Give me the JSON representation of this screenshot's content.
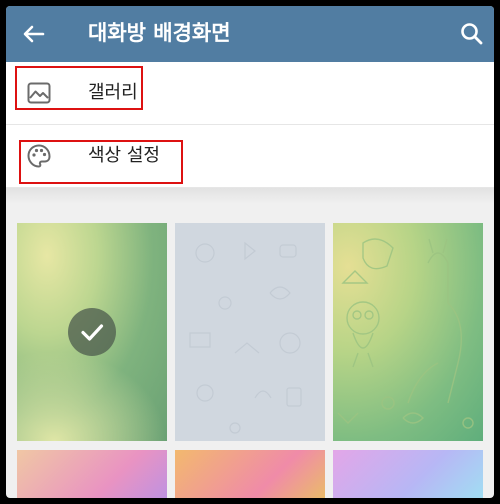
{
  "appbar": {
    "title": "대화방 배경화면",
    "back_icon": "arrow-left-icon",
    "search_icon": "search-icon"
  },
  "menu": {
    "items": [
      {
        "label": "갤러리",
        "icon": "image-icon"
      },
      {
        "label": "색상 설정",
        "icon": "palette-icon"
      }
    ]
  },
  "wallpapers": {
    "selected_index": 0,
    "colors": {
      "appbar": "#517da2",
      "highlight": "#dd1111"
    }
  }
}
